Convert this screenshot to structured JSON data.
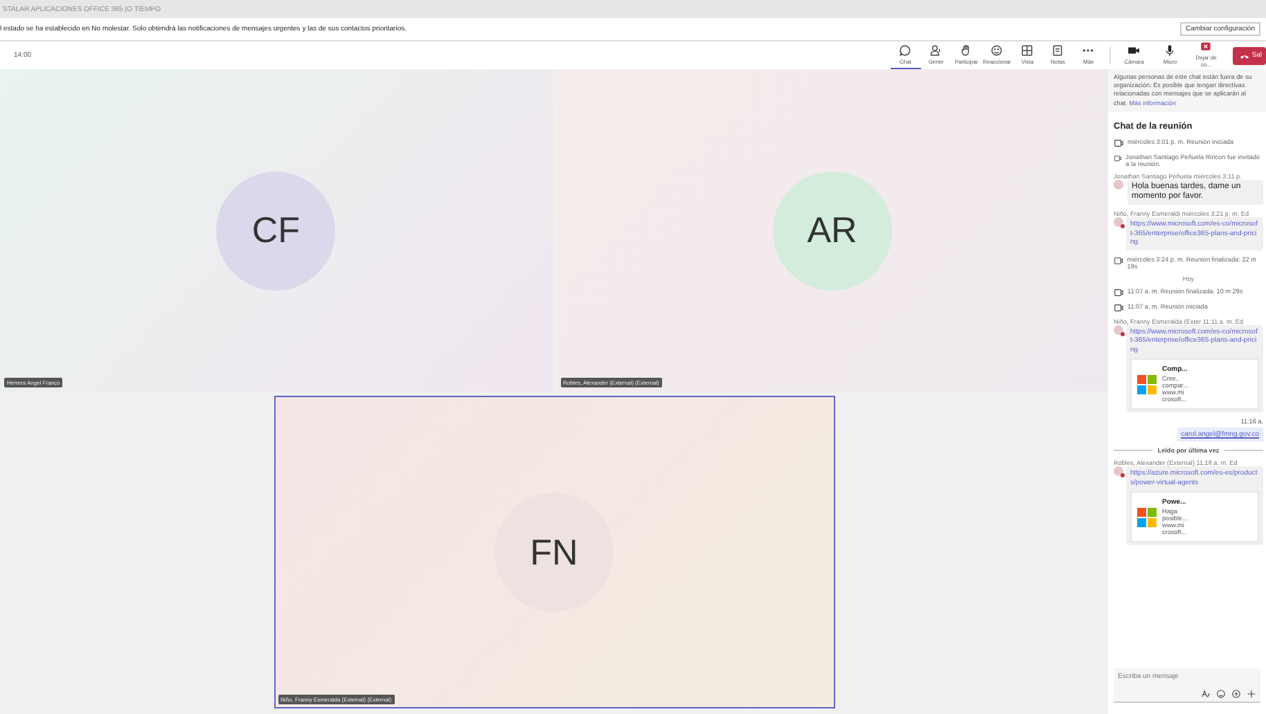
{
  "window": {
    "title": "STALAR APLICACIONES OFFICE 365 (O TIEMPO"
  },
  "notice_bar": {
    "text": "l estado se ha establecido en No molestar. Solo obtendrá las notificaciones de mensajes urgentes y las de sus contactos prioritarios.",
    "button": "Cambiar configuración"
  },
  "toolbar": {
    "time": "14:00",
    "items": [
      {
        "label": "Chat",
        "selected": true
      },
      {
        "label": "Gente",
        "selected": false
      },
      {
        "label": "Participar",
        "selected": false
      },
      {
        "label": "Reaccionar",
        "selected": false
      },
      {
        "label": "Vista",
        "selected": false
      },
      {
        "label": "Notas",
        "selected": false
      },
      {
        "label": "Más",
        "selected": false
      }
    ],
    "devices": [
      {
        "label": "Cámara"
      },
      {
        "label": "Micro"
      },
      {
        "label": "Dejar de co..."
      }
    ],
    "leave_button": "Sal"
  },
  "tiles": [
    {
      "initials": "CF",
      "name": "Herrera Angel Franco",
      "color": "#dcd8ec",
      "active": false
    },
    {
      "initials": "AR",
      "name": "Robles, Alexander (External) (External)",
      "color": "#d3ecdc",
      "active": false
    },
    {
      "initials": "FN",
      "name": "Niño, Franny Esmeralda (External) (External)",
      "color": "#ede2e0",
      "active": true
    }
  ],
  "chat": {
    "notice": "Algunas personas de este chat están fuera de su organización. Es posible que tengan directivas relacionadas con mensajes que se aplicarán al chat.",
    "notice_link": "Más información",
    "title": "Chat de la reunión",
    "items": [
      {
        "kind": "event",
        "text": "miércoles 3:01 p. m.   Reunión iniciada"
      },
      {
        "kind": "event",
        "text": "Jonathan Santiago Peñuela Rincon fue invitado a la reunión."
      },
      {
        "kind": "message",
        "sender": "Jonathan Santiago Peñuela  miércoles 3:11 p.",
        "text": "Hola buenas tardes, dame un momento por favor."
      },
      {
        "kind": "link",
        "sender": "Niño, Franny Esmeraldi  miércoles 3:21 p. m.  Ed",
        "link": "https://www.microsoft.com/es-co/microsoft-365/enterprise/office365-plans-and-pricing"
      },
      {
        "kind": "event",
        "text": "miércoles 3:24 p. m.   Reunión finalizada: 22 m 19s"
      },
      {
        "kind": "day",
        "text": "Hoy"
      },
      {
        "kind": "event",
        "text": "11:07 a. m.   Reunión finalizada: 10 m 29s"
      },
      {
        "kind": "event",
        "text": "11:07 a. m.   Reunión iniciada"
      },
      {
        "kind": "link",
        "sender": "Niño, Franny Esmeralda (Exter  11:11 a. m.  Ed",
        "link": "https://www.microsoft.com/es-co/microsoft-365/enterprise/office365-plans-and-pricing",
        "card_title": "Comp...",
        "card_text": "Cree, compar... www.mi crosoft..."
      },
      {
        "kind": "own",
        "time": "11:16 a.",
        "text": "carol.angel@fmng.gov.co"
      },
      {
        "kind": "read",
        "text": "Leído por última vez"
      },
      {
        "kind": "link",
        "sender": "Robles, Alexander (External)  11:18 a. m.  Ed",
        "link": "https://azure.microsoft.com/es-es/products/power-virtual-agents",
        "card_title": "Powe...",
        "card_text": "Haga posible... www.mi crosoft..."
      }
    ],
    "compose": {
      "placeholder": "Escriba un mensaje"
    }
  }
}
